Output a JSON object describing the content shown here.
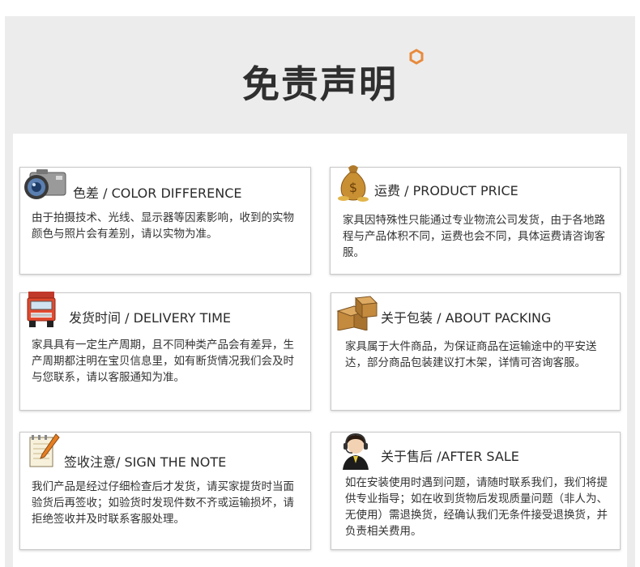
{
  "header": {
    "title": "免责声明"
  },
  "cards": [
    {
      "title": "色差 / COLOR DIFFERENCE",
      "body": "由于拍摄技术、光线、显示器等因素影响，收到的实物颜色与照片会有差别，请以实物为准。",
      "icon": "camera-icon"
    },
    {
      "title": "运费 / PRODUCT PRICE",
      "body": "家具因特殊性只能通过专业物流公司发货，由于各地路程与产品体积不同，运费也会不同，具体运费请咨询客服。",
      "icon": "money-bag-icon"
    },
    {
      "title": "发货时间 / DELIVERY TIME",
      "body": "家具具有一定生产周期，且不同种类产品会有差异，生产周期都注明在宝贝信息里，如有断货情况我们会及时与您联系，请以客服通知为准。",
      "icon": "truck-icon"
    },
    {
      "title": "关于包装 / ABOUT PACKING",
      "body": "家具属于大件商品，为保证商品在运输途中的平安送达，部分商品包装建议打木架，详情可咨询客服。",
      "icon": "boxes-icon"
    },
    {
      "title": "签收注意/ SIGN THE NOTE",
      "body": "我们产品是经过仔细检查后才发货，请买家提货时当面验货后再签收；如验货时发现件数不齐或运输损坏，请拒绝签收并及时联系客服处理。",
      "icon": "notepad-pen-icon"
    },
    {
      "title": "关于售后 /AFTER SALE",
      "body": "如在安装使用时遇到问题，请随时联系我们，我们将提供专业指导；如在收到货物后发现质量问题（非人为、无使用）需退换货，经确认我们无条件接受退换货，并负责相关费用。",
      "icon": "customer-service-icon"
    }
  ]
}
